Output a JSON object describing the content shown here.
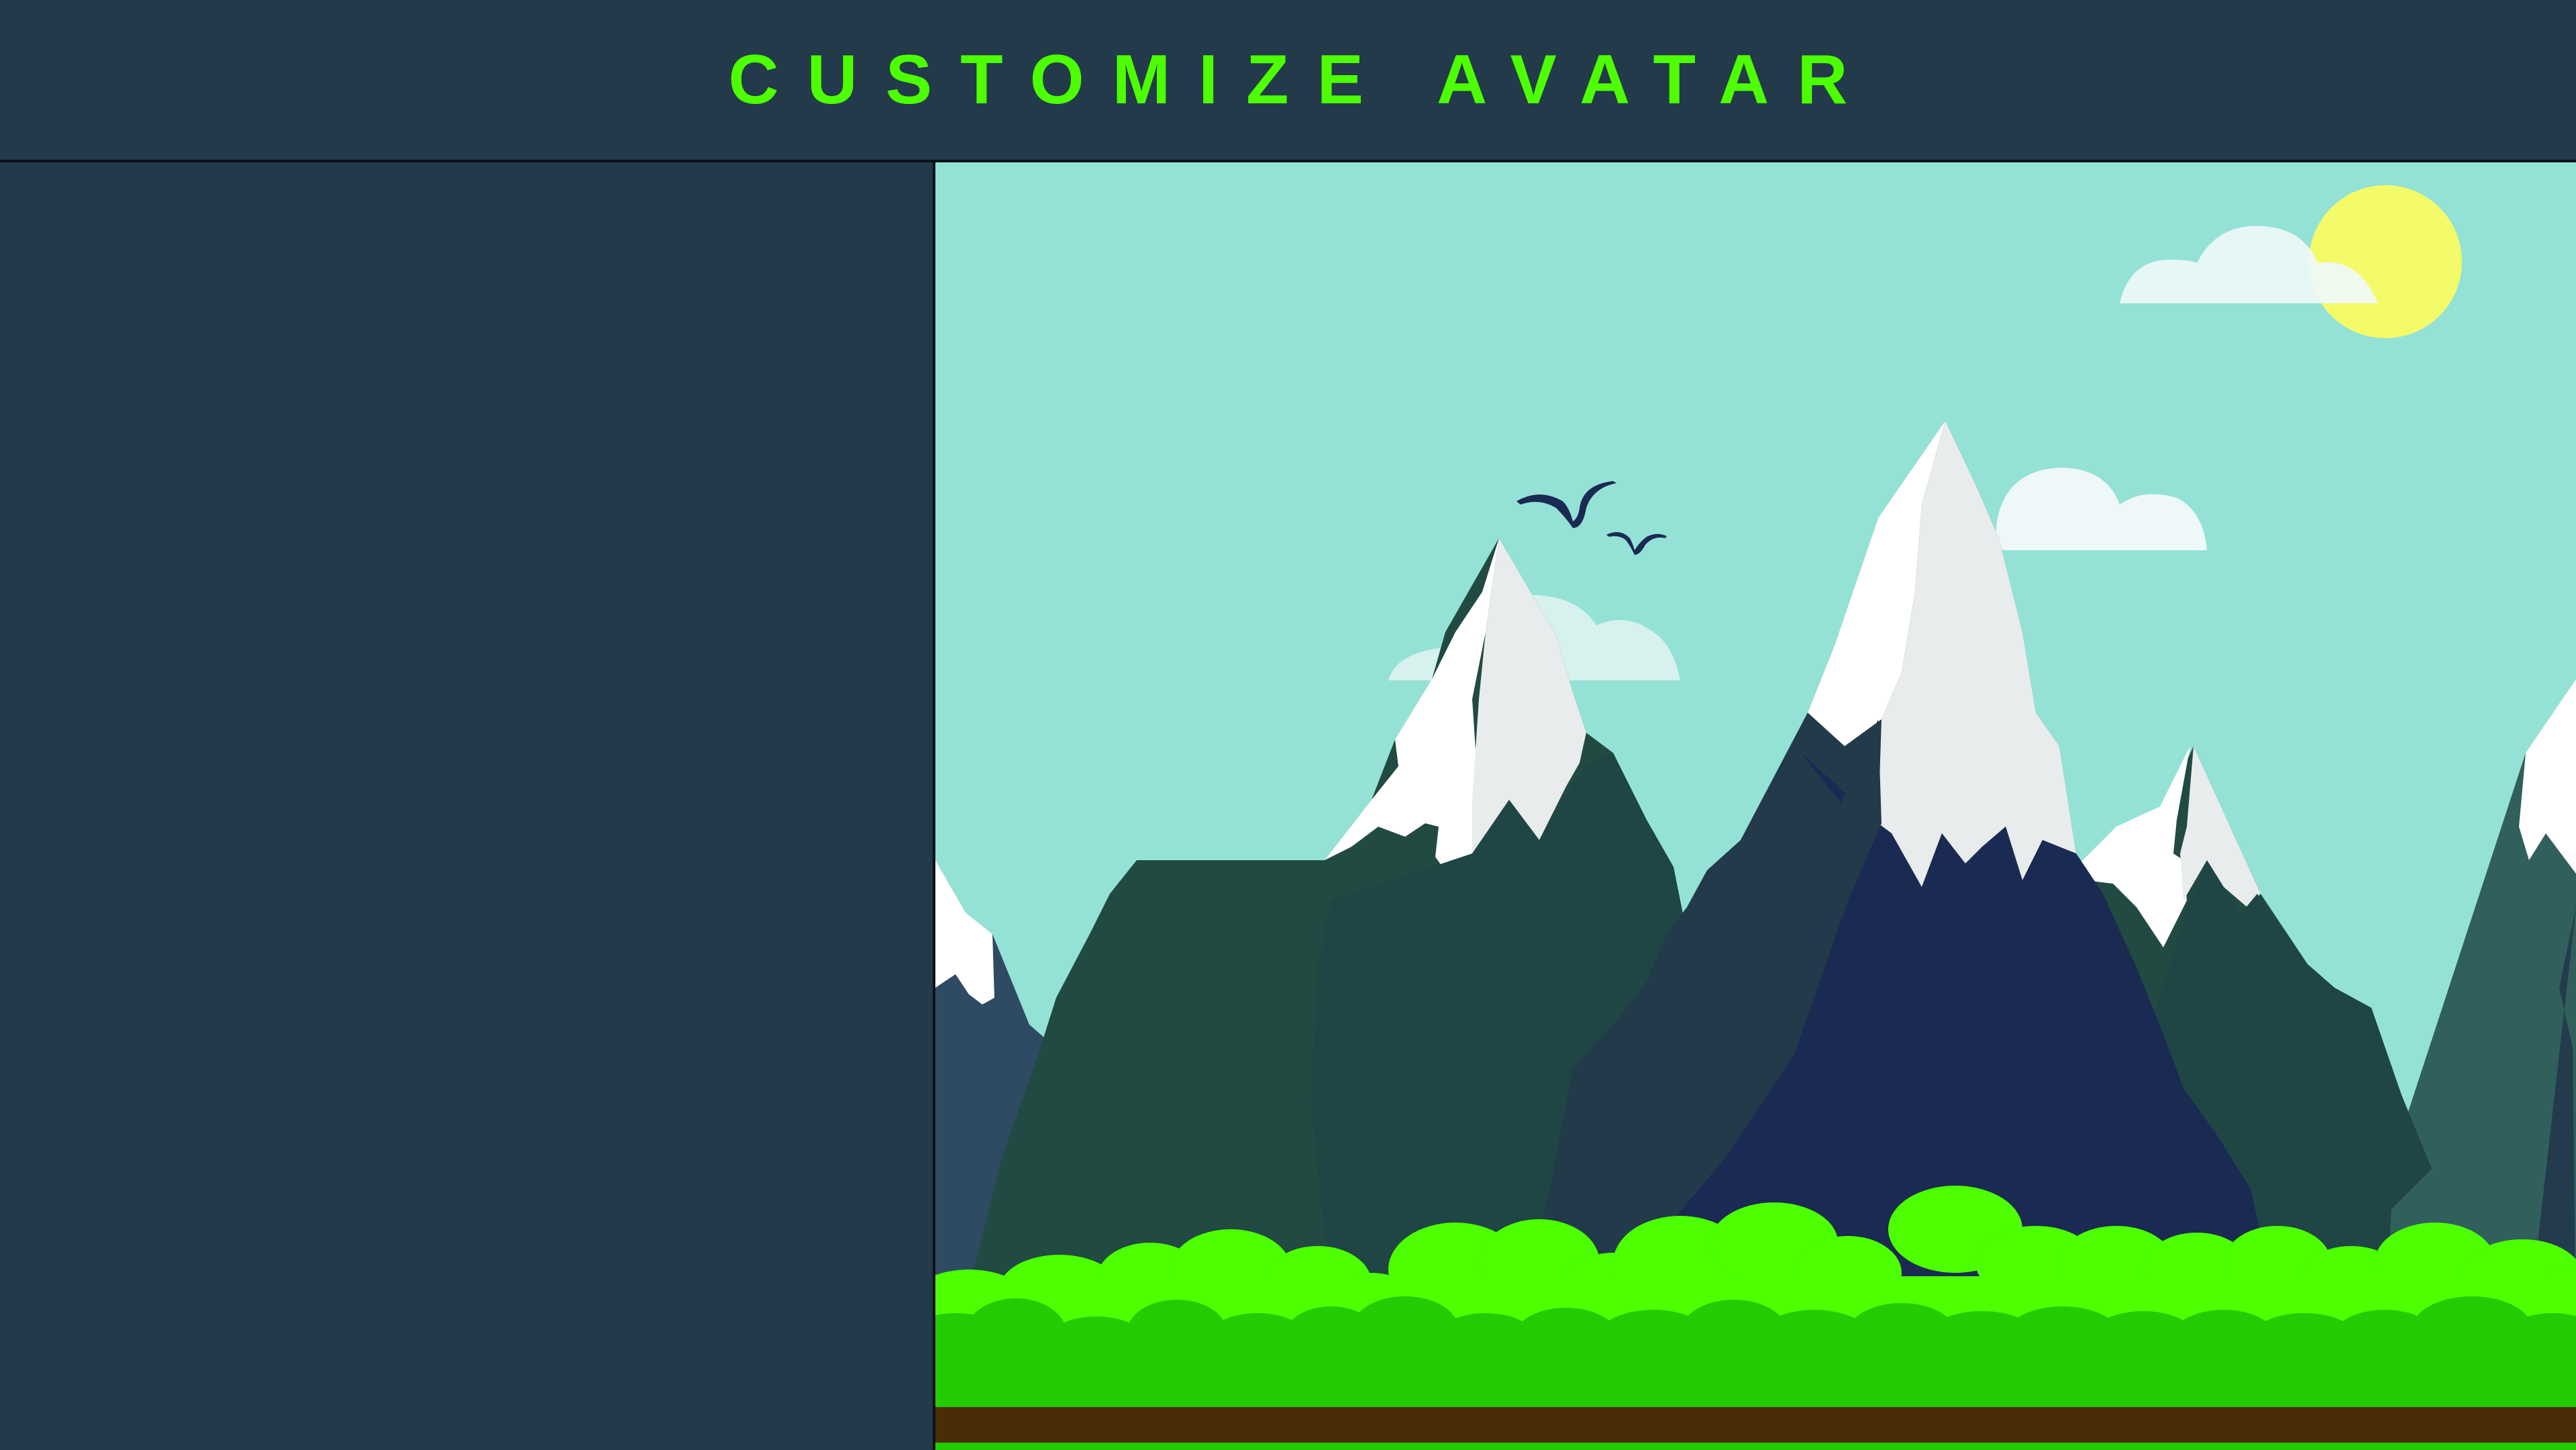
{
  "header": {
    "title": "CUSTOMIZE AVATAR"
  },
  "colors": {
    "background": "#223a4a",
    "title": "#4dff00",
    "sky": "#94e2d6",
    "sun": "#f4fb69",
    "cloud": "#eaf6f6",
    "snow": "#ffffff",
    "snow_shade": "#e8ecec",
    "mountain_dark_green": "#224a42",
    "mountain_navy": "#1a2a52",
    "mountain_slate": "#233b4c",
    "grass_light": "#4dff00",
    "grass_dark": "#22cc00",
    "soil": "#4a2d06",
    "bird": "#1a2a52"
  },
  "scene": {
    "elements": [
      "sun",
      "clouds",
      "birds",
      "snowy-mountains",
      "bushes",
      "ground"
    ]
  }
}
